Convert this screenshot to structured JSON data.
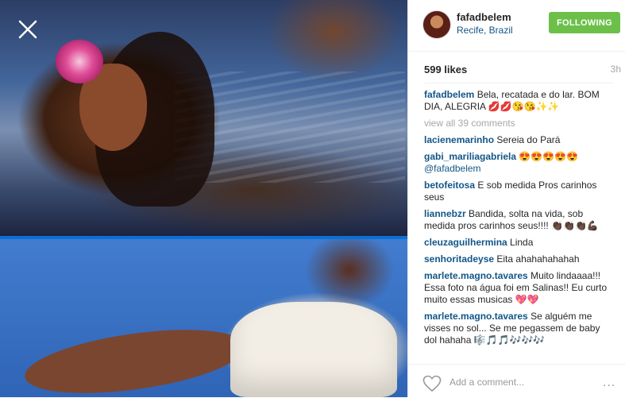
{
  "post": {
    "username": "fafadbelem",
    "location": "Recife, Brazil",
    "follow_label": "FOLLOWING",
    "likes": "599 likes",
    "time": "3h",
    "view_all": "view all 39 comments",
    "add_comment_placeholder": "Add a comment...",
    "more_label": "..."
  },
  "caption": {
    "user": "fafadbelem",
    "text": "Bela, recatada e do lar. BOM DIA, ALEGRIA 💋💋😘😘✨✨"
  },
  "comments": [
    {
      "user": "lacienemarinho",
      "text": "Sereia do Pará"
    },
    {
      "user": "gabi_mariliagabriela",
      "text": "😍😍😍😍😍",
      "mention": "@fafadbelem"
    },
    {
      "user": "betofeitosa",
      "text": "E sob medida Pros carinhos seus"
    },
    {
      "user": "liannebzr",
      "text": "Bandida, solta na vida, sob medida pros carinhos seus!!!! 👏🏿👏🏿👏🏿💪🏿"
    },
    {
      "user": "cleuzaguilhermina",
      "text": "Linda"
    },
    {
      "user": "senhoritadeyse",
      "text": "Eita ahahahahahah"
    },
    {
      "user": "marlete.magno.tavares",
      "text": "Muito lindaaaa!!! Essa foto na água foi em Salinas!! Eu curto muito essas musicas 💖💖"
    },
    {
      "user": "marlete.magno.tavares",
      "text": "Se alguém me visses no sol... Se me pegassem de baby dol hahaha 🎼🎵🎵🎶🎶🎶"
    }
  ],
  "icons": {
    "close": "close-icon",
    "heart": "heart-icon",
    "more": "more-options-icon"
  },
  "colors": {
    "follow_green": "#6cc04a",
    "link_blue": "#125688",
    "divider_blue": "#0c6fd6"
  }
}
